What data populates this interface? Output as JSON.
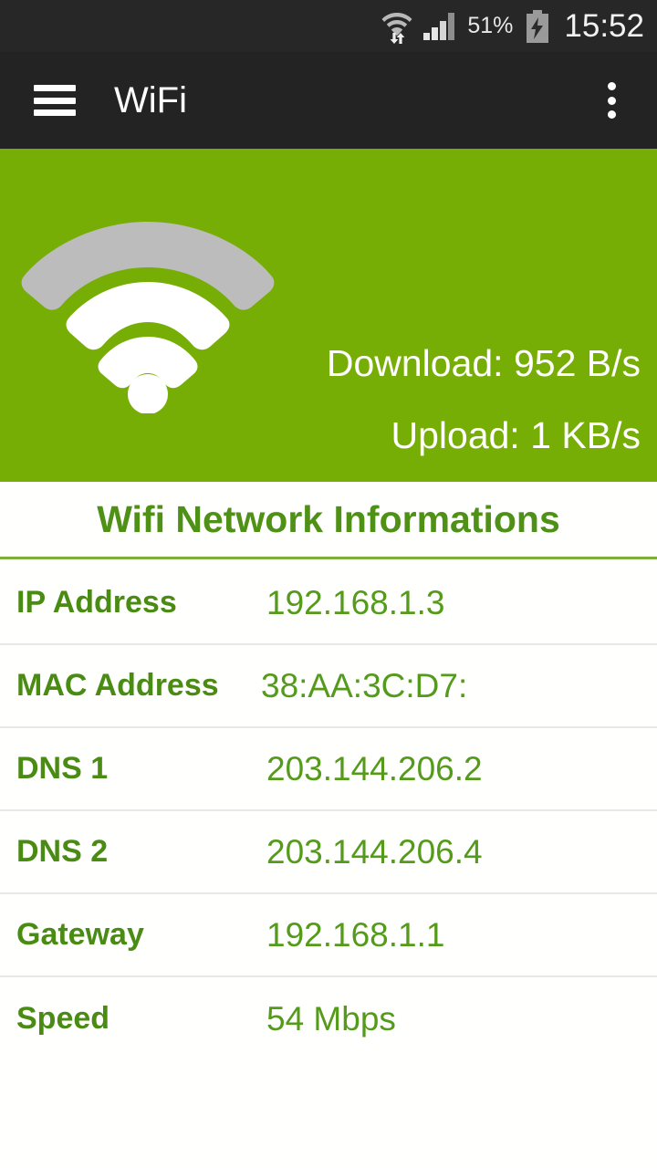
{
  "status_bar": {
    "wifi_icon": "wifi-transfer-icon",
    "signal_icon": "cellular-signal-icon",
    "battery_percent": "51%",
    "battery_icon": "battery-charging-icon",
    "time": "15:52"
  },
  "app_bar": {
    "menu_icon": "hamburger-menu-icon",
    "title": "WiFi",
    "overflow_icon": "overflow-menu-icon"
  },
  "hero": {
    "wifi_icon": "wifi-signal-icon",
    "download_label": "Download: 952 B/s",
    "upload_label": "Upload: 1 KB/s",
    "background_color": "#76ae06"
  },
  "info": {
    "section_title": "Wifi Network Informations",
    "rows": [
      {
        "label": "IP Address",
        "value": "192.168.1.3"
      },
      {
        "label": "MAC Address",
        "value": "38:AA:3C:D7:"
      },
      {
        "label": "DNS 1",
        "value": "203.144.206.2"
      },
      {
        "label": "DNS 2",
        "value": "203.144.206.4"
      },
      {
        "label": "Gateway",
        "value": "192.168.1.1"
      },
      {
        "label": "Speed",
        "value": "54 Mbps"
      }
    ]
  },
  "colors": {
    "accent_green": "#76ae06",
    "label_green": "#4a8b14",
    "value_green": "#559b1b",
    "title_green": "#4f9116",
    "appbar_dark": "#232323",
    "statusbar_dark": "#272727"
  }
}
